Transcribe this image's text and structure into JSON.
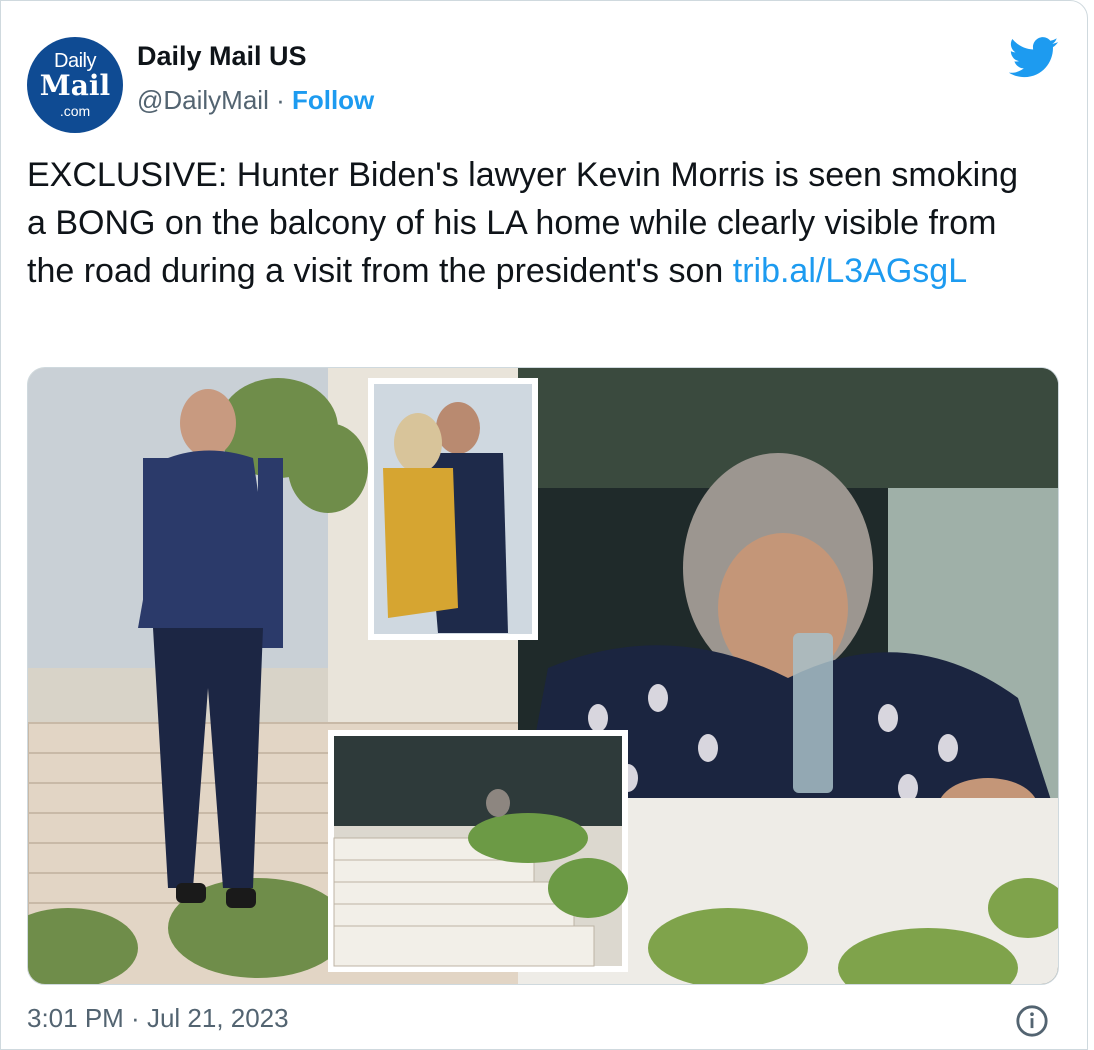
{
  "account": {
    "avatar_line1": "Daily",
    "avatar_line2": "Mail",
    "avatar_line3": ".com",
    "display_name": "Daily Mail US",
    "handle": "@DailyMail",
    "separator": " · ",
    "follow_label": "Follow"
  },
  "tweet": {
    "text": "EXCLUSIVE: Hunter Biden's lawyer Kevin Morris is seen smoking a BONG on the balcony of his LA home while clearly visible from the road during a visit from the president's son ",
    "link_text": "trib.al/L3AGsgL"
  },
  "footer": {
    "time": "3:01 PM",
    "separator": " · ",
    "date": "Jul 21, 2023"
  },
  "icons": {
    "brand": "twitter-bird-icon",
    "info": "info-icon"
  },
  "colors": {
    "accent": "#1d9bf0",
    "avatar_bg": "#0f4b93",
    "text": "#0f1419",
    "muted": "#536471"
  }
}
